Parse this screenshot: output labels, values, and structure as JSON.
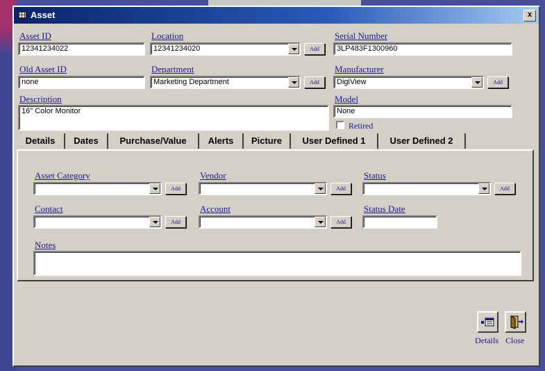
{
  "window": {
    "title": "Asset",
    "close_symbol": "x"
  },
  "fields": {
    "asset_id": {
      "label": "Asset ID",
      "value": "12341234022"
    },
    "location": {
      "label": "Location",
      "value": "12341234020"
    },
    "serial_number": {
      "label": "Serial Number",
      "value": "3LP483F1300960"
    },
    "old_asset_id": {
      "label": "Old Asset ID",
      "value": "none"
    },
    "department": {
      "label": "Department",
      "value": "Marketing Department"
    },
    "manufacturer": {
      "label": "Manufacturer",
      "value": "DigiView"
    },
    "description": {
      "label": "Description",
      "value": "16\" Color Monitor"
    },
    "model": {
      "label": "Model",
      "value": "None"
    },
    "retired": {
      "label": "Retired",
      "checked": false
    }
  },
  "add_label": "Add",
  "tabs": [
    {
      "label": "Details",
      "active": true
    },
    {
      "label": "Dates"
    },
    {
      "label": "Purchase/Value"
    },
    {
      "label": "Alerts"
    },
    {
      "label": "Picture"
    },
    {
      "label": "User Defined 1"
    },
    {
      "label": "User Defined 2"
    }
  ],
  "details": {
    "asset_category": {
      "label": "Asset Category",
      "value": ""
    },
    "vendor": {
      "label": "Vendor",
      "value": ""
    },
    "status": {
      "label": "Status",
      "value": ""
    },
    "contact": {
      "label": "Contact",
      "value": ""
    },
    "account": {
      "label": "Account",
      "value": ""
    },
    "status_date": {
      "label": "Status Date",
      "value": ""
    },
    "notes": {
      "label": "Notes",
      "value": ""
    }
  },
  "footer": {
    "details_label": "Details",
    "close_label": "Close"
  },
  "icons": {
    "details": "details-icon",
    "close": "exit-door-icon",
    "window": "form-icon"
  }
}
